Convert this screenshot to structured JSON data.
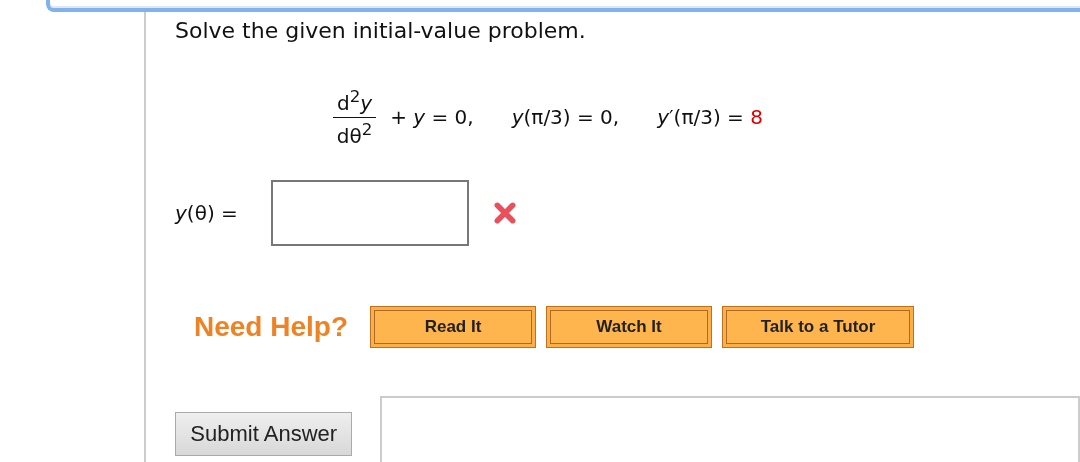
{
  "question": {
    "prompt": "Solve the given initial-value problem.",
    "equation": {
      "numerator": "d$^{2}$*y*",
      "denominator": "dθ$^{2}$",
      "rest": "+ *y* = 0,",
      "conditions": [
        {
          "text": "*y*(π/3) = 0,"
        },
        {
          "text": "*y*′(π/3) =",
          "given_value": "8"
        }
      ]
    },
    "answer": {
      "label": "*y*(θ) =",
      "marked_incorrect": true
    }
  },
  "help": {
    "label": "Need Help?",
    "buttons": [
      "Read It",
      "Watch It",
      "Talk to a Tutor"
    ]
  },
  "submit_button": "Submit Answer"
}
